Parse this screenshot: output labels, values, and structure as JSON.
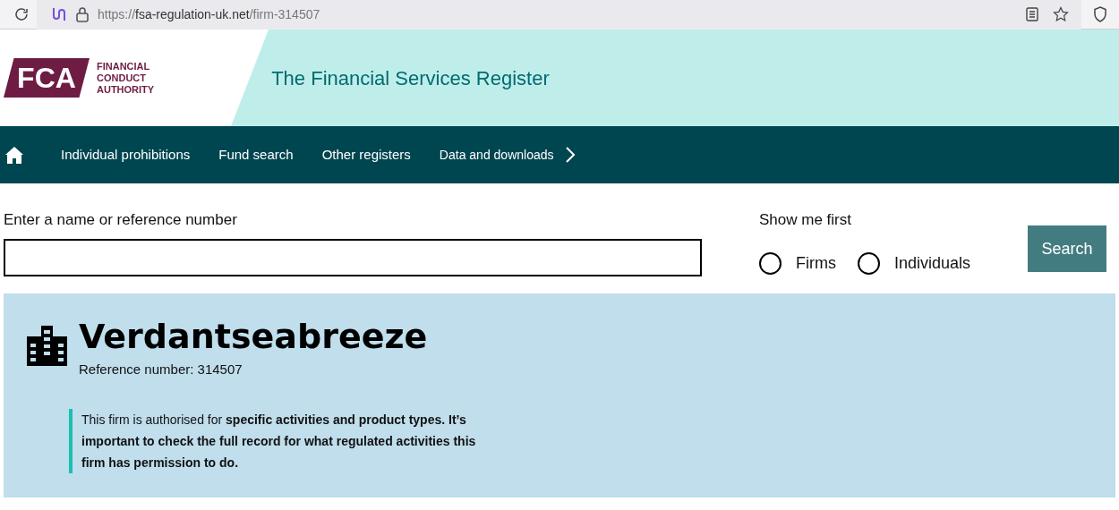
{
  "browser": {
    "url": {
      "scheme": "https://",
      "host": "fsa-regulation-uk.net",
      "path": "/firm-314507"
    }
  },
  "header": {
    "logo": {
      "mark": "FCA",
      "words": [
        "FINANCIAL",
        "CONDUCT",
        "AUTHORITY"
      ]
    },
    "title": "The Financial Services Register"
  },
  "nav": {
    "items": [
      "Individual prohibitions",
      "Fund search",
      "Other registers",
      "Data and downloads"
    ]
  },
  "search": {
    "label": "Enter a name or reference number",
    "show_me_first": {
      "label": "Show me first",
      "options": [
        {
          "label": "Firms",
          "selected": false
        },
        {
          "label": "Individuals",
          "selected": false
        }
      ]
    },
    "button": "Search"
  },
  "firm": {
    "name": "Verdantseabreeze",
    "reference": "Reference number: 314507",
    "notice": "This firm is authorised for **specific activities and product types. It’s important to check the full record for what regulated activities this firm has permission to do.**"
  }
}
